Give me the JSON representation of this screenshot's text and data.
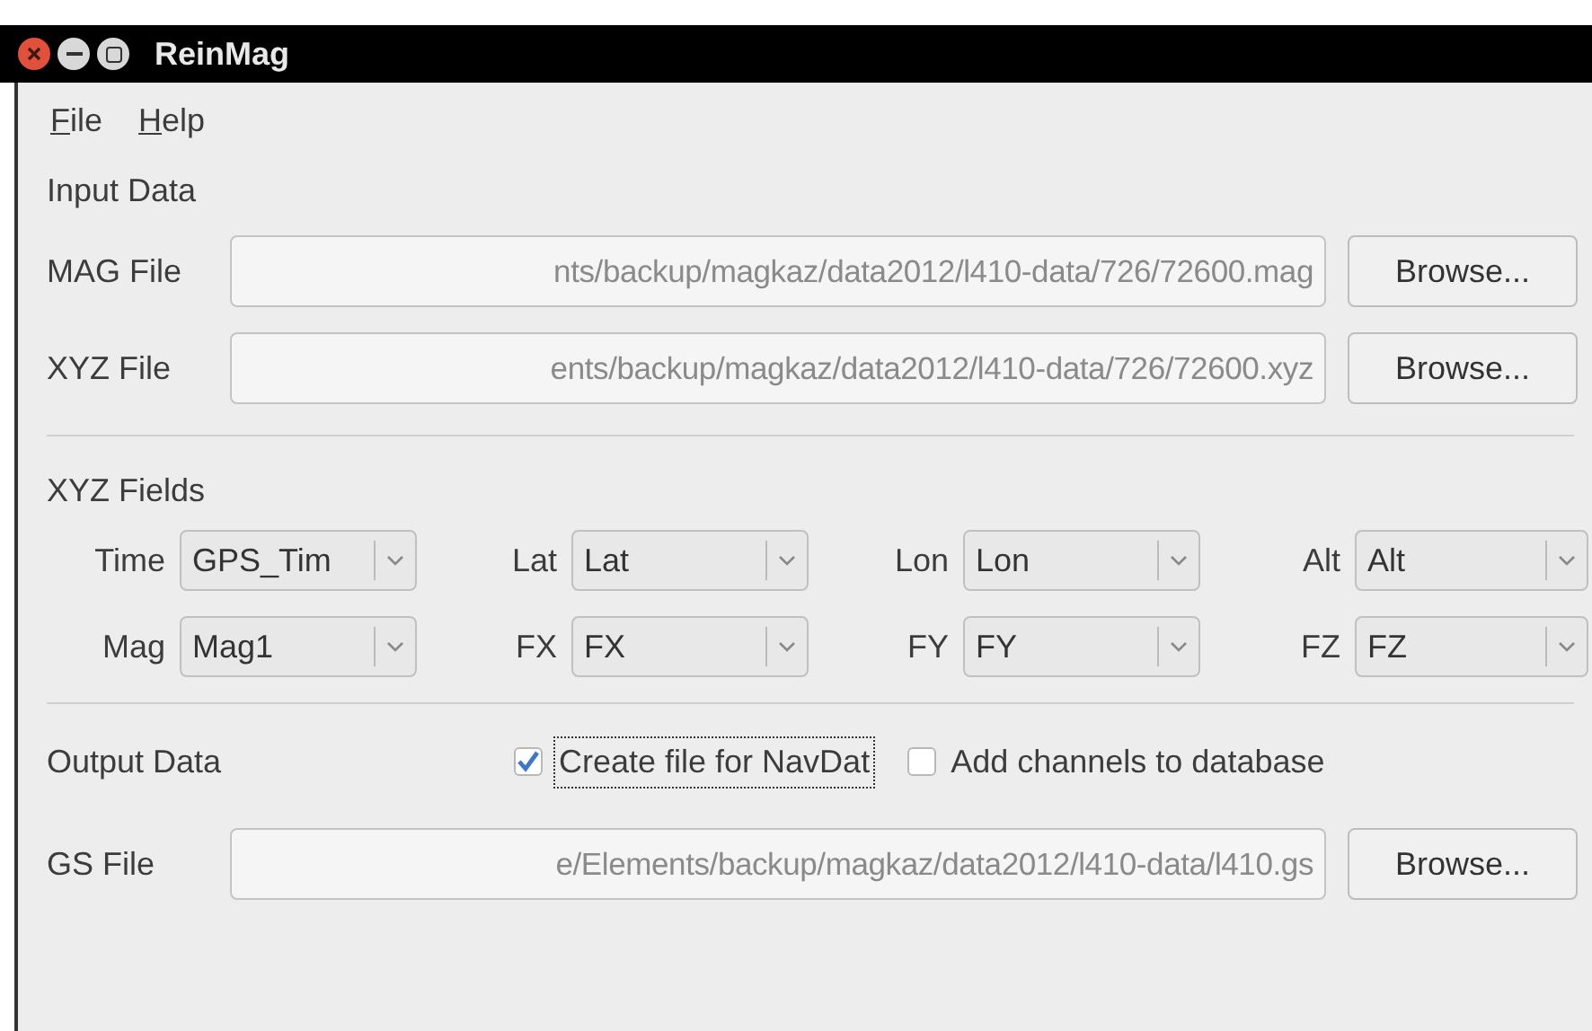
{
  "window": {
    "title": "ReinMag"
  },
  "menu": [
    "File",
    "Help"
  ],
  "input_data": {
    "heading": "Input Data",
    "rows": [
      {
        "label": "MAG File",
        "value": "nts/backup/magkaz/data2012/l410-data/726/72600.mag",
        "button": "Browse..."
      },
      {
        "label": "XYZ File",
        "value": "ents/backup/magkaz/data2012/l410-data/726/72600.xyz",
        "button": "Browse..."
      }
    ]
  },
  "xyz_fields": {
    "heading": "XYZ Fields",
    "fields": [
      {
        "label": "Time",
        "value": "GPS_Tim"
      },
      {
        "label": "Lat",
        "value": "Lat"
      },
      {
        "label": "Lon",
        "value": "Lon"
      },
      {
        "label": "Alt",
        "value": "Alt"
      },
      {
        "label": "Mag",
        "value": "Mag1"
      },
      {
        "label": "FX",
        "value": "FX"
      },
      {
        "label": "FY",
        "value": "FY"
      },
      {
        "label": "FZ",
        "value": "FZ"
      }
    ]
  },
  "output_data": {
    "heading": "Output Data",
    "options": [
      {
        "label": "Create file for NavDat",
        "checked": true
      },
      {
        "label": "Add channels to database",
        "checked": false
      }
    ],
    "rows": [
      {
        "label": "GS File",
        "value": "e/Elements/backup/magkaz/data2012/l410-data/l410.gs",
        "button": "Browse..."
      }
    ]
  }
}
